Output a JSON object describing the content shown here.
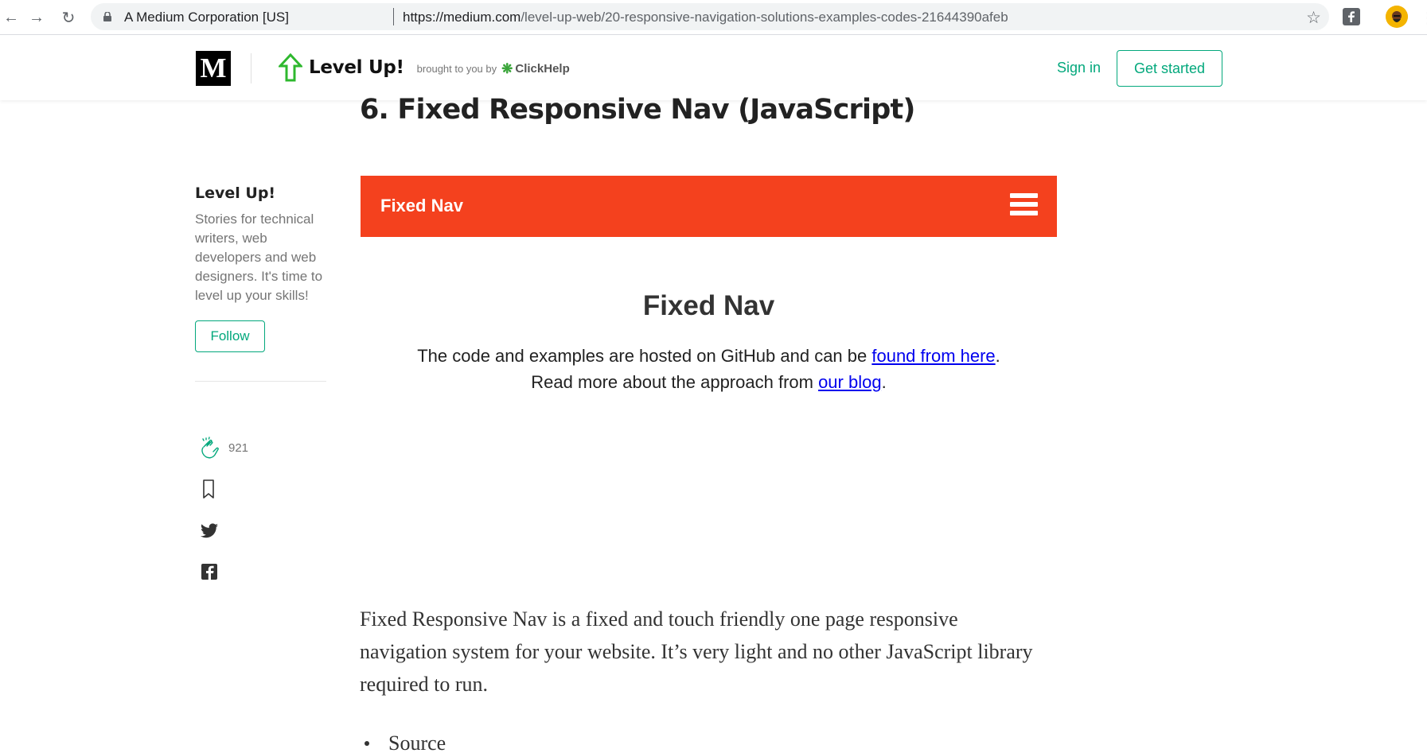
{
  "browser": {
    "site_name": "A Medium Corporation [US]",
    "url_domain": "https://medium.com",
    "url_path": "/level-up-web/20-responsive-navigation-solutions-examples-codes-21644390afeb",
    "icons": [
      "back-icon",
      "forward-icon",
      "reload-icon",
      "lock-icon",
      "star-icon",
      "facebook-extension-icon",
      "profile-avatar",
      "menu-icon"
    ]
  },
  "header": {
    "logo_letter": "M",
    "publication_name": "Level Up!",
    "brought_by": "brought to you by",
    "sponsor_name": "ClickHelp",
    "sign_in": "Sign in",
    "get_started": "Get started",
    "accent_color": "#03a87c"
  },
  "article": {
    "heading": "6. Fixed Responsive Nav (JavaScript)",
    "body": "Fixed Responsive Nav is a fixed and touch friendly one page responsive navigation system for your website. It’s very light and no other JavaScript library required to run.",
    "bullets": [
      "Source"
    ]
  },
  "sidebar": {
    "title": "Level Up!",
    "description": "Stories for technical writers, web developers and web designers. It's time to level up your skills!",
    "follow": "Follow",
    "clap_count": "921",
    "icons": [
      "clap-icon",
      "bookmark-icon",
      "twitter-icon",
      "facebook-icon"
    ]
  },
  "demo": {
    "nav_logo": "Fixed Nav",
    "nav_color": "#f4411e",
    "heading": "Fixed Nav",
    "line1_text": "The code and examples are hosted on GitHub and can be ",
    "line1_link": "found from here",
    "line1_end": ".",
    "line2_text": "Read more about the approach from ",
    "line2_link": "our blog",
    "line2_end": "."
  }
}
